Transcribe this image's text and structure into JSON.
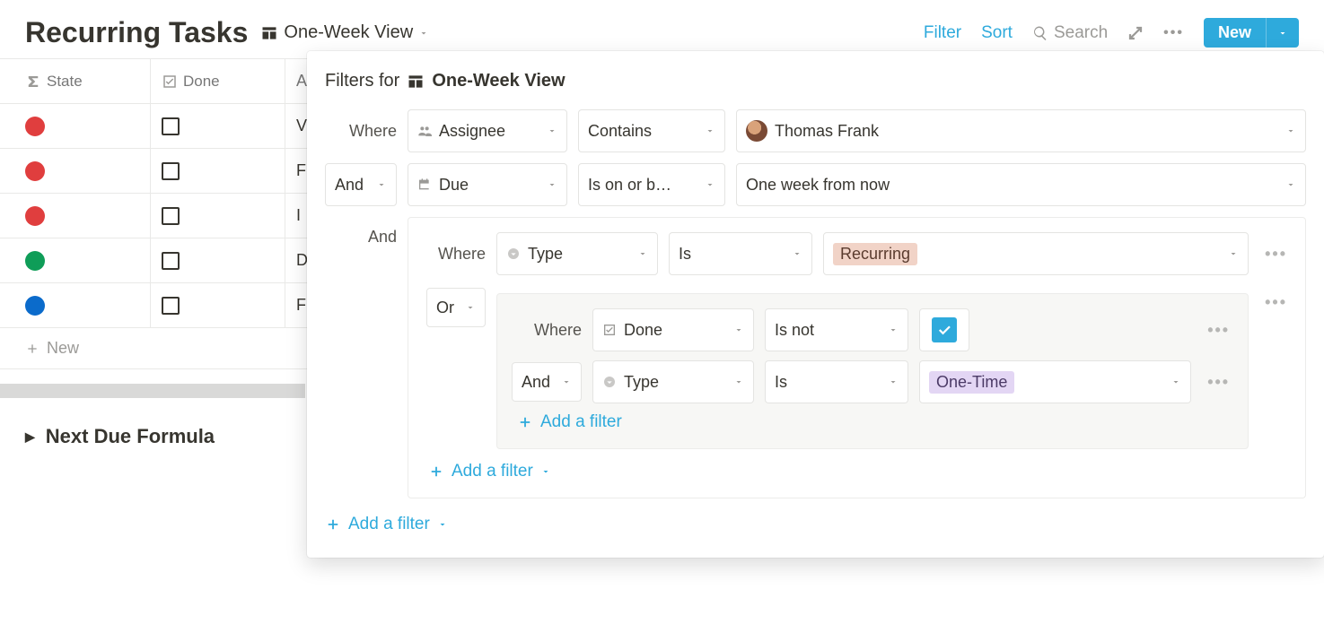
{
  "header": {
    "title": "Recurring Tasks",
    "view_name": "One-Week View",
    "filter_link": "Filter",
    "sort_link": "Sort",
    "search_label": "Search",
    "new_button": "New"
  },
  "columns": {
    "state": "State",
    "done": "Done",
    "third_initial": "A"
  },
  "rows": [
    {
      "state_color": "red",
      "name_initial": "V"
    },
    {
      "state_color": "red",
      "name_initial": "F"
    },
    {
      "state_color": "red",
      "name_initial": "I"
    },
    {
      "state_color": "green",
      "name_initial": "D"
    },
    {
      "state_color": "blue",
      "name_initial": "F"
    }
  ],
  "new_row_label": "New",
  "toggle_heading": "Next Due Formula",
  "filter_panel": {
    "title_prefix": "Filters for",
    "view_name": "One-Week View",
    "rule1": {
      "conjunction": "Where",
      "property": "Assignee",
      "operator": "Contains",
      "value": "Thomas Frank"
    },
    "rule2": {
      "conjunction": "And",
      "property": "Due",
      "operator": "Is on or b…",
      "value": "One week from now"
    },
    "group": {
      "conjunction": "And",
      "ruleA": {
        "conjunction": "Where",
        "property": "Type",
        "operator": "Is",
        "value": "Recurring"
      },
      "inner": {
        "conjunction": "Or",
        "ruleB": {
          "conjunction": "Where",
          "property": "Done",
          "operator": "Is not",
          "value_checked": true
        },
        "ruleC": {
          "conjunction": "And",
          "property": "Type",
          "operator": "Is",
          "value": "One-Time"
        },
        "add_label": "Add a filter"
      },
      "add_label": "Add a filter"
    },
    "add_label": "Add a filter"
  }
}
